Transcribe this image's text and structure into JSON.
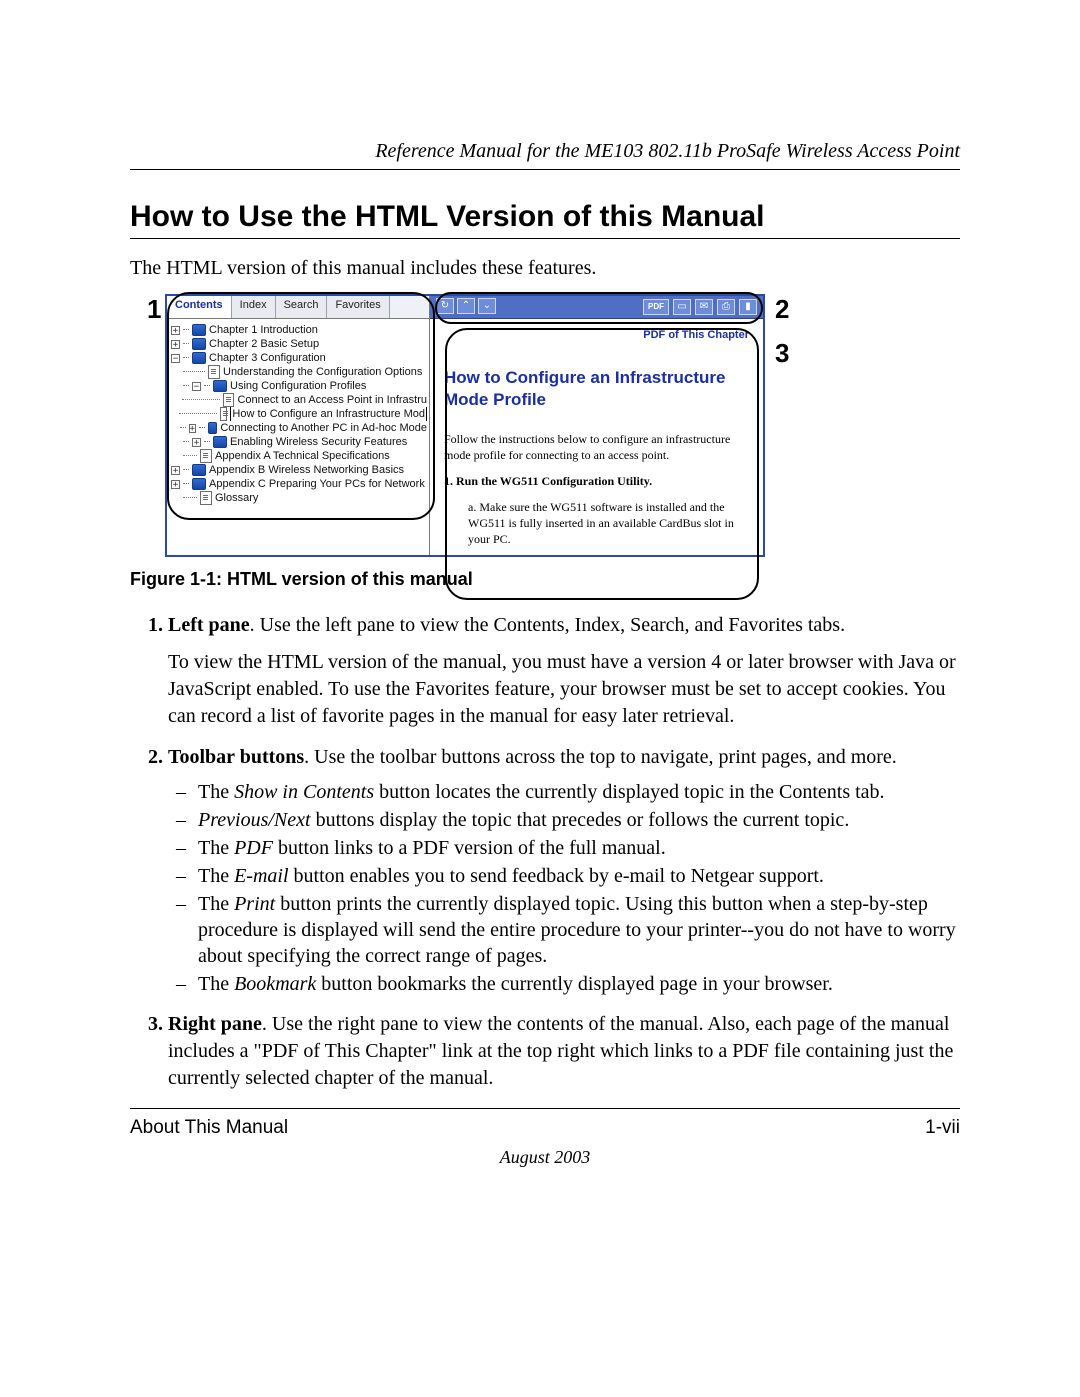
{
  "header": {
    "running_head": "Reference Manual for the ME103 802.11b ProSafe Wireless Access Point"
  },
  "section": {
    "title": "How to Use the HTML Version of this Manual",
    "intro": "The HTML version of this manual includes these features."
  },
  "figure": {
    "callouts": {
      "c1": "1",
      "c2": "2",
      "c3": "3"
    },
    "tabs": {
      "contents": "Contents",
      "index": "Index",
      "search": "Search",
      "favorites": "Favorites"
    },
    "tree": {
      "ch1": "Chapter 1  Introduction",
      "ch2": "Chapter 2  Basic Setup",
      "ch3": "Chapter 3  Configuration",
      "ch3a": "Understanding the Configuration Options",
      "ch3b": "Using Configuration Profiles",
      "ch3b1": "Connect to an Access Point in Infrastru",
      "ch3b2": "How to Configure an Infrastructure Mod",
      "ch3c": "Connecting to Another PC in Ad-hoc Mode",
      "ch3d": "Enabling Wireless Security Features",
      "apA": "Appendix A  Technical Specifications",
      "apB": "Appendix B  Wireless Networking Basics",
      "apC": "Appendix C  Preparing Your PCs for Network",
      "glos": "Glossary"
    },
    "toolbar": {
      "show_in_contents": "↻",
      "prev": "⌃",
      "next": "⌄",
      "pdf": "PDF",
      "page": "▭",
      "email": "✉",
      "print": "⎙",
      "bookmark": "▮"
    },
    "content": {
      "pdf_link": "PDF of This Chapter",
      "heading": "How to Configure an Infrastructure Mode Profile",
      "para": "Follow the instructions below to configure an infrastructure mode profile for connecting to an access point.",
      "step1": "1. Run the WG511 Configuration Utility.",
      "step1a": "a.  Make sure the WG511 software is installed and the WG511 is fully inserted in an available CardBus slot in your PC."
    },
    "caption": "Figure 1-1:  HTML version of this manual"
  },
  "list": {
    "item1_title": "Left pane",
    "item1_text": ". Use the left pane to view the Contents, Index, Search, and Favorites tabs.",
    "item1_para": "To view the HTML version of the manual, you must have a version 4 or later browser with Java or JavaScript enabled. To use the Favorites feature, your browser must be set to accept cookies. You can record a list of favorite pages in the manual for easy later retrieval.",
    "item2_title": "Toolbar buttons",
    "item2_text": ". Use the toolbar buttons across the top to navigate, print pages, and more.",
    "sub": {
      "s1a": "Show in Contents",
      "s1b": " button locates the currently displayed topic in the Contents tab.",
      "s2a": "Previous/Next",
      "s2b": " buttons display the topic that precedes or follows the current topic.",
      "s3a": "PDF",
      "s3b": " button links to a PDF version of the full manual.",
      "s4a": "E-mail",
      "s4b": " button enables you to send feedback by e-mail to Netgear support.",
      "s5a": "Print",
      "s5b": " button prints the currently displayed topic. Using this button when a step-by-step procedure is displayed will send the entire procedure to your printer--you do not have to worry about specifying the correct range of pages.",
      "s6a": "Bookmark",
      "s6b": " button bookmarks the currently displayed page in your browser."
    },
    "item3_title": "Right pane",
    "item3_text": ". Use the right pane to view the contents of the manual. Also, each page of the manual includes a \"PDF of This Chapter\" link at the top right which links to a PDF file containing just the currently selected chapter of the manual."
  },
  "footer": {
    "left": "About This Manual",
    "right": "1-vii",
    "date": "August 2003"
  },
  "static": {
    "the_prefix": "The "
  }
}
